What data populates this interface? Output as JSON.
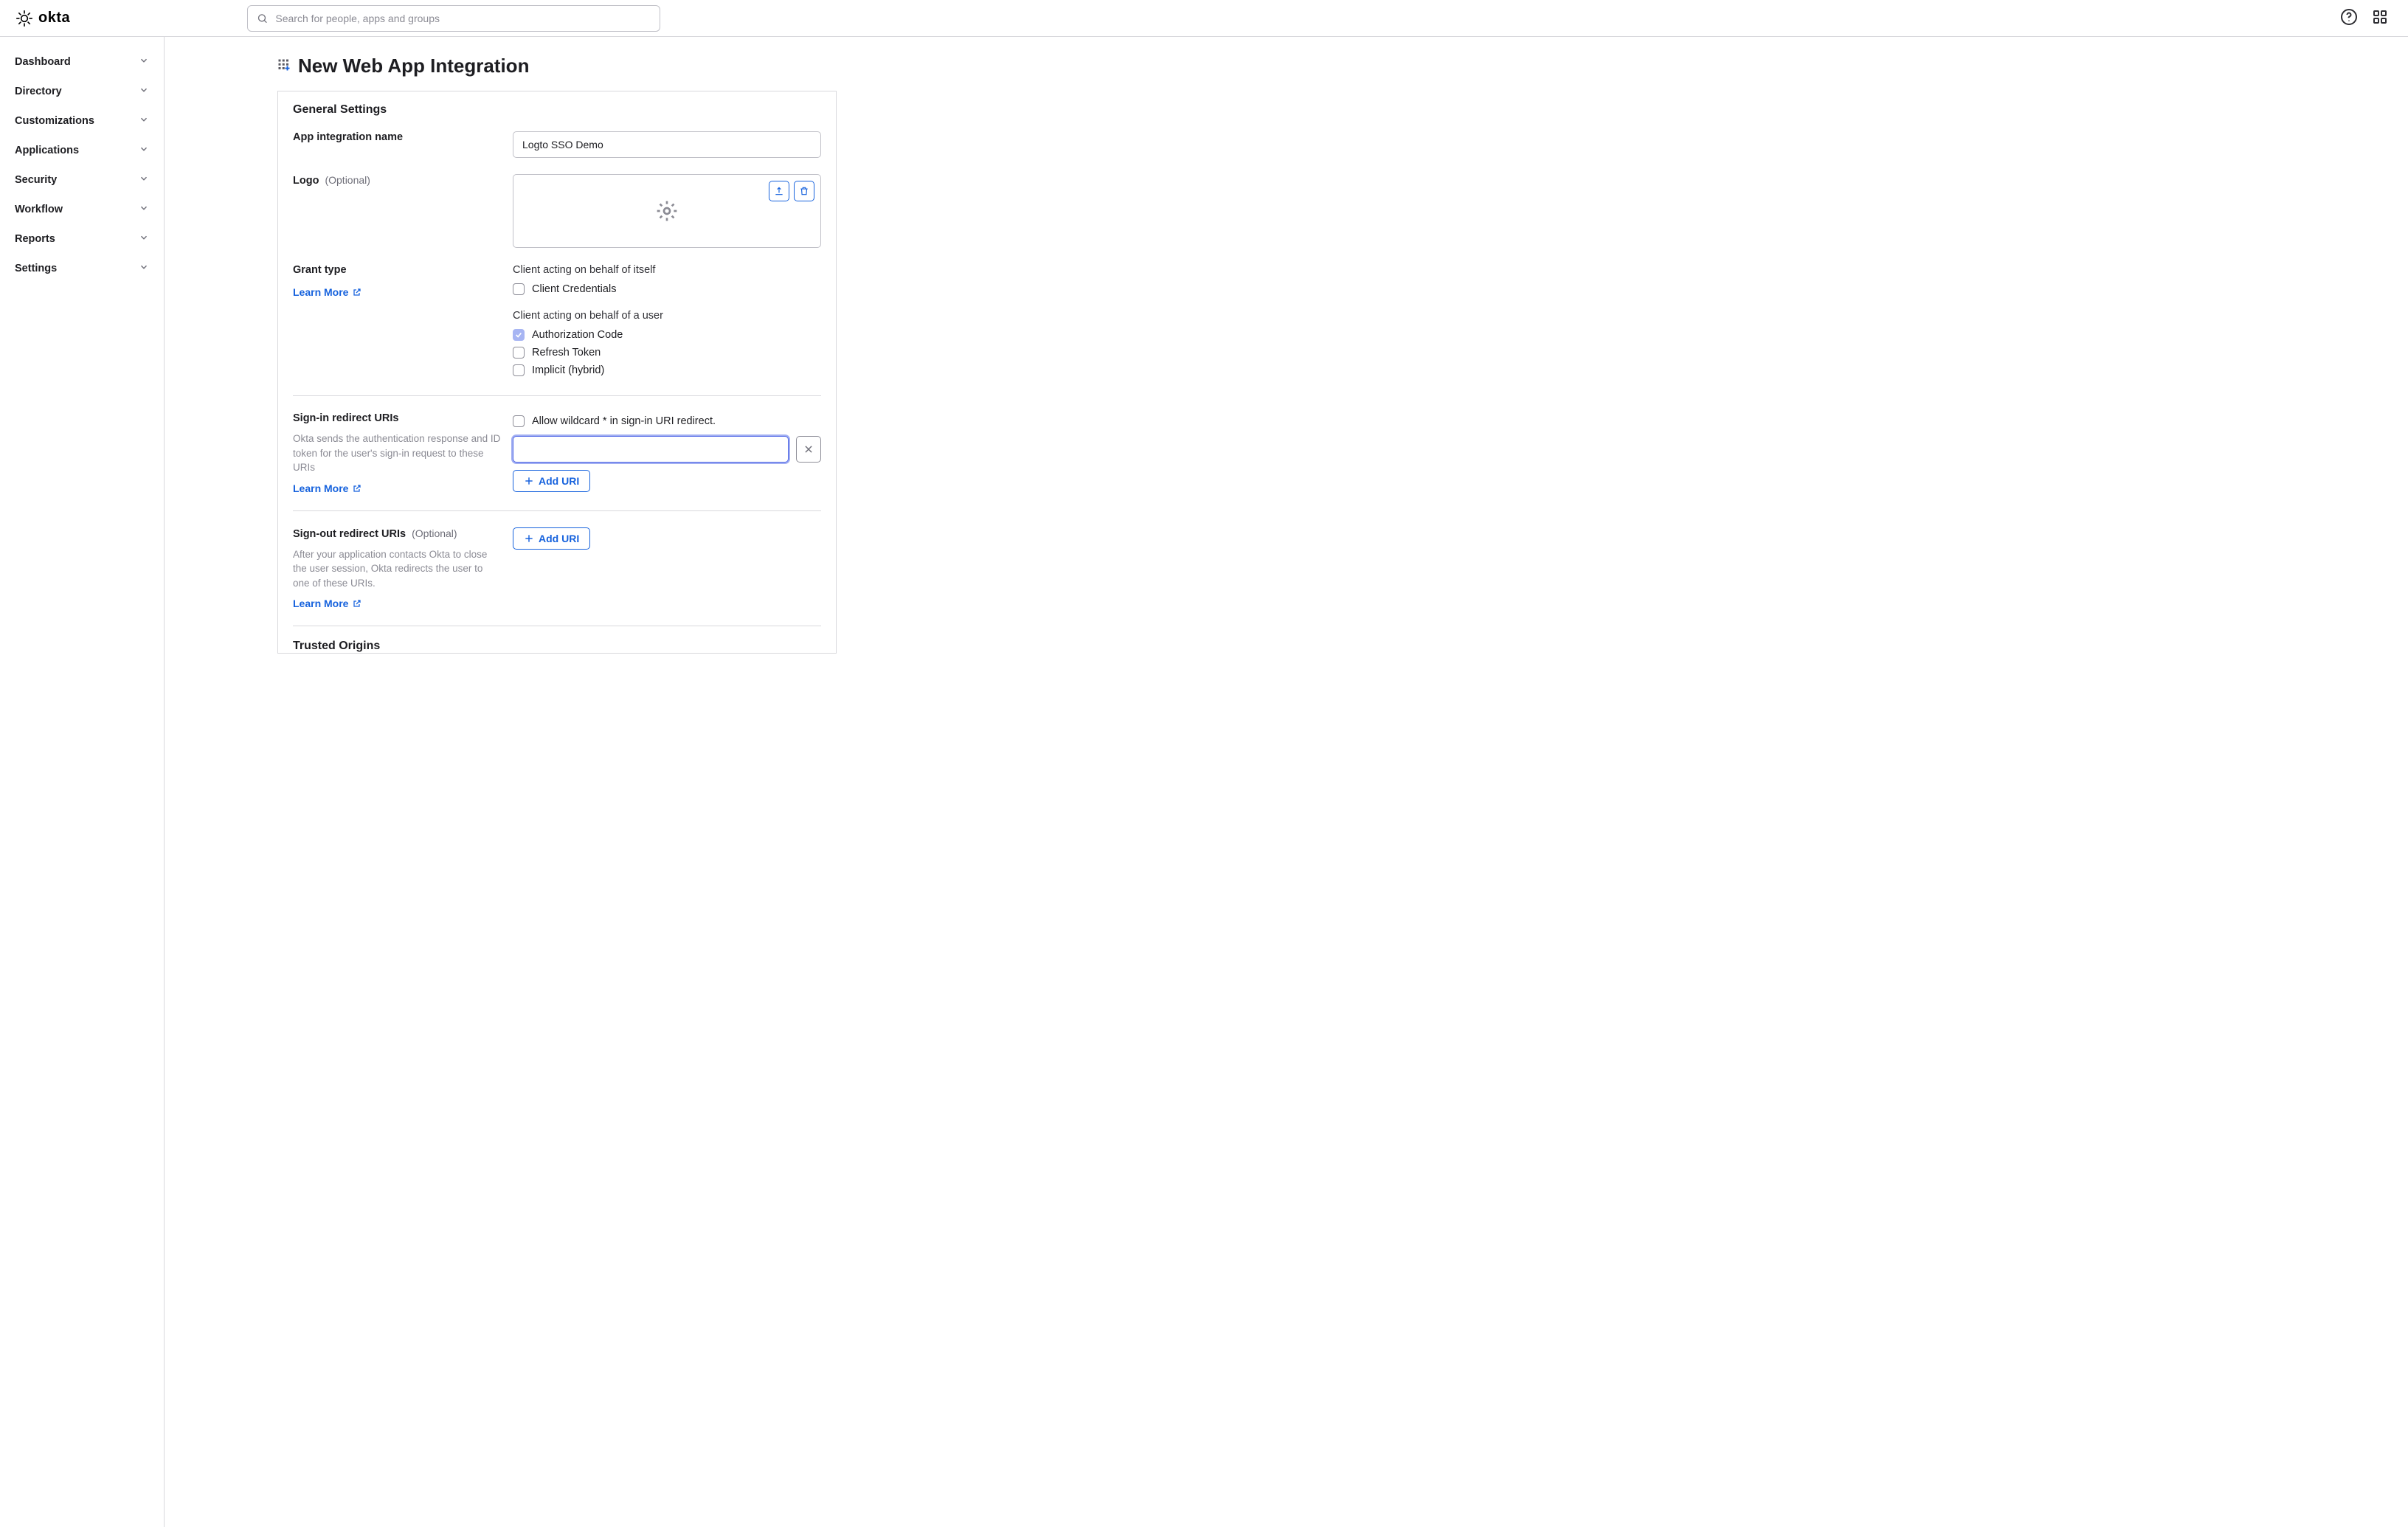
{
  "search": {
    "placeholder": "Search for people, apps and groups"
  },
  "nav": {
    "items": [
      {
        "label": "Dashboard"
      },
      {
        "label": "Directory"
      },
      {
        "label": "Customizations"
      },
      {
        "label": "Applications"
      },
      {
        "label": "Security"
      },
      {
        "label": "Workflow"
      },
      {
        "label": "Reports"
      },
      {
        "label": "Settings"
      }
    ]
  },
  "page": {
    "title": "New Web App Integration"
  },
  "sections": {
    "general": {
      "title": "General Settings",
      "app_name_label": "App integration name",
      "app_name_value": "Logto SSO Demo",
      "logo_label": "Logo",
      "logo_optional": "(Optional)"
    },
    "grant": {
      "label": "Grant type",
      "learn_more": "Learn More",
      "self_heading": "Client acting on behalf of itself",
      "client_credentials": "Client Credentials",
      "user_heading": "Client acting on behalf of a user",
      "auth_code": "Authorization Code",
      "refresh_token": "Refresh Token",
      "implicit": "Implicit (hybrid)"
    },
    "signin": {
      "label": "Sign-in redirect URIs",
      "help": "Okta sends the authentication response and ID token for the user's sign-in request to these URIs",
      "learn_more": "Learn More",
      "wildcard_label": "Allow wildcard * in sign-in URI redirect.",
      "uri_value": "",
      "add_uri": "Add URI"
    },
    "signout": {
      "label": "Sign-out redirect URIs",
      "optional": "(Optional)",
      "help": "After your application contacts Okta to close the user session, Okta redirects the user to one of these URIs.",
      "learn_more": "Learn More",
      "add_uri": "Add URI"
    },
    "trusted": {
      "title": "Trusted Origins"
    }
  }
}
